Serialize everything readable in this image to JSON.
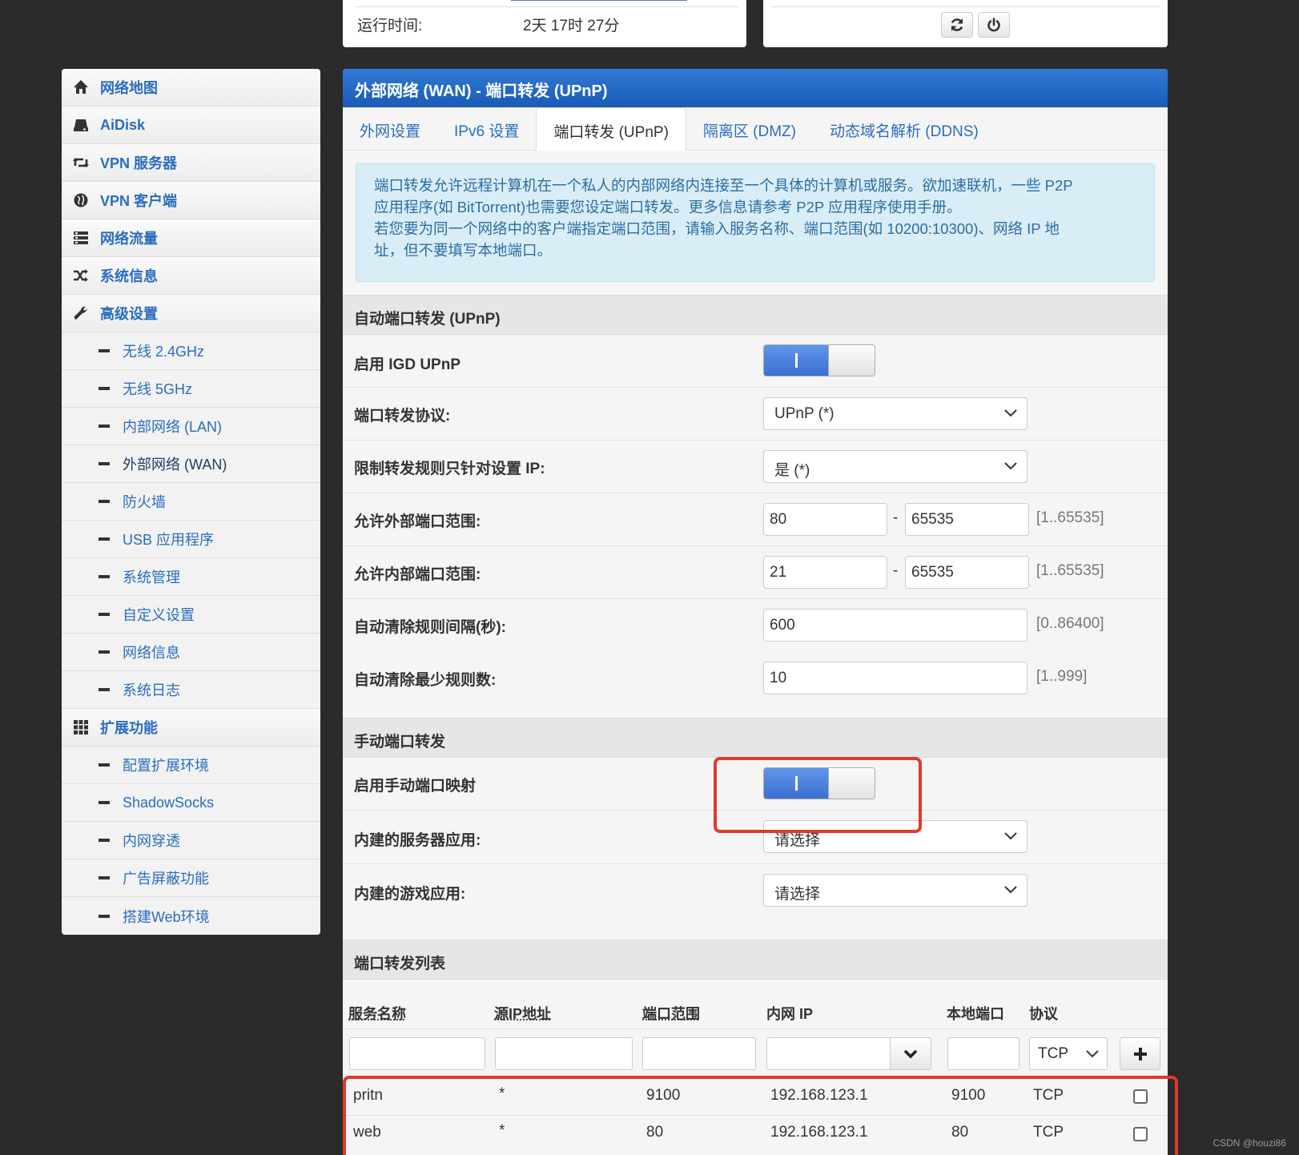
{
  "status": {
    "uptime_label": "运行时间:",
    "uptime_value": "2天 17时 27分"
  },
  "sidebar": {
    "items": [
      {
        "label": "网络地图",
        "icon": "home-icon"
      },
      {
        "label": "AiDisk",
        "icon": "disk-icon"
      },
      {
        "label": "VPN 服务器",
        "icon": "retweet-icon"
      },
      {
        "label": "VPN 客户端",
        "icon": "globe-icon"
      },
      {
        "label": "网络流量",
        "icon": "tasks-icon"
      },
      {
        "label": "系统信息",
        "icon": "random-icon"
      },
      {
        "label": "高级设置",
        "icon": "wrench-icon"
      }
    ],
    "advanced": [
      "无线 2.4GHz",
      "无线 5GHz",
      "内部网络 (LAN)",
      "外部网络 (WAN)",
      "防火墙",
      "USB 应用程序",
      "系统管理",
      "自定义设置",
      "网络信息",
      "系统日志"
    ],
    "extensions_label": "扩展功能",
    "extensions": [
      "配置扩展环境",
      "ShadowSocks",
      "内网穿透",
      "广告屏蔽功能",
      "搭建Web环境"
    ]
  },
  "main": {
    "title": "外部网络 (WAN) - 端口转发 (UPnP)",
    "tabs": [
      "外网设置",
      "IPv6 设置",
      "端口转发 (UPnP)",
      "隔离区 (DMZ)",
      "动态域名解析 (DDNS)"
    ],
    "info": [
      "端口转发允许远程计算机在一个私人的内部网络内连接至一个具体的计算机或服务。欲加速联机，一些 P2P",
      "应用程序(如 BitTorrent)也需要您设定端口转发。更多信息请参考 P2P 应用程序使用手册。",
      "若您要为同一个网络中的客户端指定端口范围，请输入服务名称、端口范围(如 10200:10300)、网络 IP 地",
      "址，但不要填写本地端口。"
    ],
    "auto_section": "自动端口转发 (UPnP)",
    "igd_label": "启用 IGD UPnP",
    "protocol_label": "端口转发协议:",
    "protocol_value": "UPnP (*)",
    "restrict_label": "限制转发规则只针对设置 IP:",
    "restrict_value": "是 (*)",
    "ext_range_label": "允许外部端口范围:",
    "ext_from": "80",
    "ext_to": "65535",
    "ext_hint": "[1..65535]",
    "int_range_label": "允许内部端口范围:",
    "int_from": "21",
    "int_to": "65535",
    "int_hint": "[1..65535]",
    "clean_interval_label": "自动清除规则间隔(秒):",
    "clean_interval": "600",
    "clean_interval_hint": "[0..86400]",
    "clean_min_label": "自动清除最少规则数:",
    "clean_min": "10",
    "clean_min_hint": "[1..999]",
    "manual_section": "手动端口转发",
    "manual_enable_label": "启用手动端口映射",
    "server_app_label": "内建的服务器应用:",
    "server_app_value": "请选择",
    "game_app_label": "内建的游戏应用:",
    "game_app_value": "请选择",
    "list_section": "端口转发列表",
    "table_headers": [
      "服务名称",
      "源IP地址",
      "端口范围",
      "内网 IP",
      "本地端口",
      "协议"
    ],
    "new_protocol": "TCP",
    "rows": [
      {
        "name": "pritn",
        "src": "*",
        "range": "9100",
        "ip": "192.168.123.1",
        "local": "9100",
        "proto": "TCP"
      },
      {
        "name": "web",
        "src": "*",
        "range": "80",
        "ip": "192.168.123.1",
        "local": "80",
        "proto": "TCP"
      }
    ]
  },
  "watermark": "CSDN @houzi86"
}
